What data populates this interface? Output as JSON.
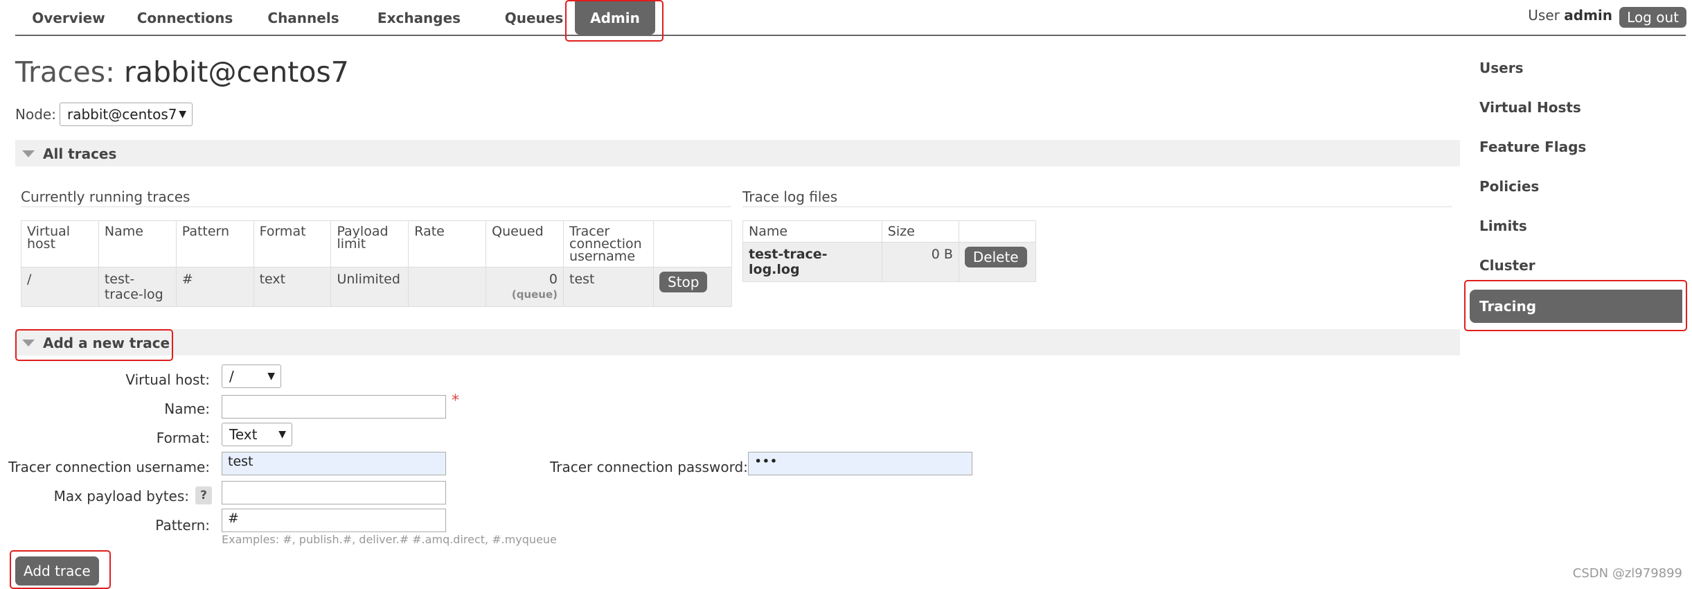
{
  "nav": {
    "tabs": [
      {
        "label": "Overview",
        "active": false
      },
      {
        "label": "Connections",
        "active": false
      },
      {
        "label": "Channels",
        "active": false
      },
      {
        "label": "Exchanges",
        "active": false
      },
      {
        "label": "Queues",
        "active": false
      },
      {
        "label": "Admin",
        "active": true
      }
    ],
    "user_prefix": "User",
    "username": "admin",
    "logout_label": "Log out"
  },
  "page": {
    "title_prefix": "Traces:",
    "title_node": "rabbit@centos7",
    "node_label": "Node:",
    "node_selected": "rabbit@centos7"
  },
  "all_traces": {
    "section_label": "All traces",
    "running": {
      "heading": "Currently running traces",
      "columns": [
        "Virtual host",
        "Name",
        "Pattern",
        "Format",
        "Payload limit",
        "Rate",
        "Queued",
        "Tracer connection username",
        ""
      ],
      "rows": [
        {
          "vhost": "/",
          "name": "test-trace-log",
          "pattern": "#",
          "format": "text",
          "payload_limit": "Unlimited",
          "rate": "",
          "queued": "0",
          "queued_sub": "(queue)",
          "username": "test",
          "action": "Stop"
        }
      ]
    },
    "logs": {
      "heading": "Trace log files",
      "columns": [
        "Name",
        "Size",
        ""
      ],
      "rows": [
        {
          "name": "test-trace-log.log",
          "size": "0 B",
          "action": "Delete"
        }
      ]
    }
  },
  "add_trace": {
    "section_label": "Add a new trace",
    "vhost_label": "Virtual host:",
    "vhost_value": "/",
    "name_label": "Name:",
    "name_value": "",
    "required_mark": "*",
    "format_label": "Format:",
    "format_value": "Text",
    "username_label": "Tracer connection username:",
    "username_value": "test",
    "password_label": "Tracer connection password:",
    "password_value": "•••",
    "max_payload_label": "Max payload bytes:",
    "max_payload_help": "?",
    "max_payload_value": "",
    "pattern_label": "Pattern:",
    "pattern_value": "#",
    "pattern_examples": "Examples: #, publish.#, deliver.# #.amq.direct, #.myqueue",
    "submit_label": "Add trace"
  },
  "sidebar": {
    "items": [
      {
        "label": "Users",
        "active": false
      },
      {
        "label": "Virtual Hosts",
        "active": false
      },
      {
        "label": "Feature Flags",
        "active": false
      },
      {
        "label": "Policies",
        "active": false
      },
      {
        "label": "Limits",
        "active": false
      },
      {
        "label": "Cluster",
        "active": false
      },
      {
        "label": "Tracing",
        "active": true
      }
    ]
  },
  "watermark": "CSDN @zl979899",
  "colors": {
    "accent_gray": "#666666",
    "highlight_red": "#e01e1e",
    "autofill_blue": "#e8f0fe"
  }
}
